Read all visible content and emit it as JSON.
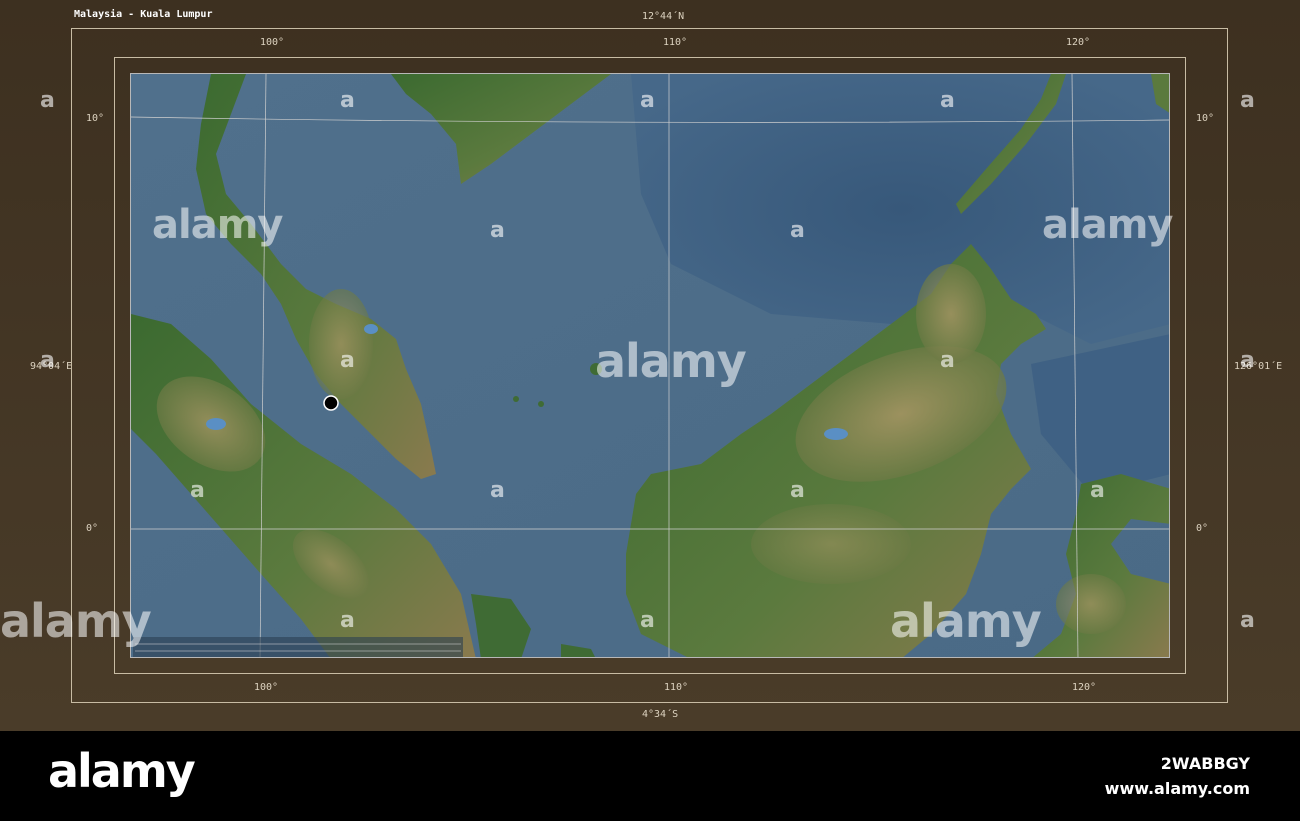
{
  "map": {
    "title": "Malaysia - Kuala Lumpur",
    "bounds": {
      "north": "12°44´N",
      "south": "4°34´S",
      "west": "94°04´E",
      "east": "126°01´E"
    },
    "longitude_labels": [
      "100°",
      "110°",
      "120°"
    ],
    "latitude_labels": [
      "10°",
      "0°"
    ],
    "marker": {
      "name": "Kuala Lumpur",
      "fill": "#000000",
      "stroke": "#ffffff"
    },
    "colors": {
      "frame": "#443626",
      "sea": "#4b6b86",
      "deep_sea": "#3d5c7a",
      "lowland": "#3f6b34",
      "highland": "#a38a5e",
      "grid": "#d0d0d0"
    }
  },
  "watermark": {
    "text": "alamy",
    "glyph": "a"
  },
  "footer": {
    "brand": "alamy",
    "image_id": "2WABBGY",
    "site": "www.alamy.com"
  }
}
